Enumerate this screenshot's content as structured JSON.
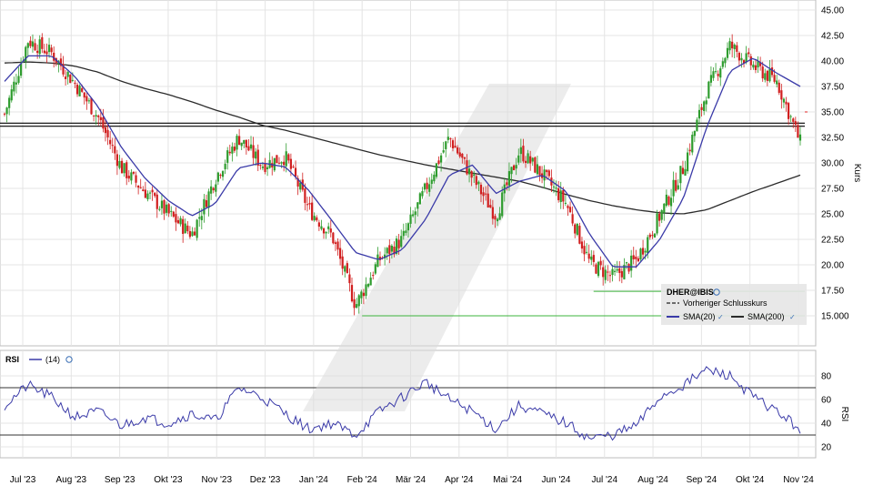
{
  "chart_data": [
    {
      "type": "candlestick",
      "title": "",
      "ylabel": "Kurs",
      "ylim": [
        12.5,
        46.2
      ],
      "y_ticks": [
        "45.00",
        "42.50",
        "40.00",
        "37.50",
        "35.00",
        "32.50",
        "30.00",
        "27.50",
        "25.00",
        "22.50",
        "20.00",
        "17.50",
        "15.000"
      ],
      "x_ticks": [
        "Jul '23",
        "Aug '23",
        "Sep '23",
        "Okt '23",
        "Nov '23",
        "Dez '23",
        "Jan '24",
        "Feb '24",
        "Mär '24",
        "Apr '24",
        "Mai '24",
        "Jun '24",
        "Jul '24",
        "Aug '24",
        "Sep '24",
        "Okt '24",
        "Nov '24"
      ],
      "grid": true,
      "legend": {
        "position": "bottom-right",
        "symbol": "DHER@IBIS",
        "items": [
          {
            "label": "Vorheriger Schlusskurs",
            "style": "dashed",
            "color": "#222222"
          },
          {
            "label": "SMA(20)",
            "style": "solid",
            "color": "#3a3aa8"
          },
          {
            "label": "SMA(200)",
            "style": "solid",
            "color": "#2b2b2b"
          }
        ]
      },
      "colors": {
        "up": "#2e9c2e",
        "down": "#d11f1f",
        "sma20": "#3a3aa8",
        "sma200": "#2b2b2b",
        "support": "#3cb43c",
        "resistance": "#e23a3a",
        "hline": "#000000"
      },
      "horizontal_lines": [
        {
          "value": 33.9,
          "color": "#000000",
          "label": ""
        },
        {
          "value": 33.6,
          "color": "#000000",
          "label": ""
        },
        {
          "value": 35.0,
          "color": "#e23a3a",
          "label": "",
          "from": "Nov '24"
        },
        {
          "value": 17.4,
          "color": "#3cb43c",
          "label": "",
          "from": "Jul '24"
        },
        {
          "value": 15.0,
          "color": "#3cb43c",
          "label": "",
          "from": "Feb '24"
        }
      ],
      "close_series": {
        "x": [
          "Jul '23",
          "",
          "Aug '23",
          "",
          "Sep '23",
          "",
          "Okt '23",
          "",
          "Nov '23",
          "",
          "Dez '23",
          "",
          "Jan '24",
          "",
          "Feb '24",
          "",
          "Mär '24",
          "",
          "Apr '24",
          "",
          "Mai '24",
          "",
          "Jun '24",
          "",
          "Jul '24",
          "",
          "Aug '24",
          "",
          "Sep '24",
          "",
          "Okt '24",
          "",
          "Nov '24",
          "",
          ""
        ],
        "values": [
          34.8,
          42.0,
          40.8,
          37.8,
          34.5,
          29.5,
          27.2,
          25.0,
          23.0,
          28.5,
          32.5,
          29.8,
          30.6,
          25.5,
          22.8,
          16.0,
          20.5,
          22.5,
          27.5,
          32.5,
          28.5,
          24.8,
          31.2,
          28.8,
          26.0,
          20.2,
          18.8,
          20.5,
          24.8,
          29.5,
          37.0,
          41.5,
          39.5,
          38.0,
          32.0
        ]
      },
      "sma20": [
        38.0,
        40.5,
        40.5,
        38.5,
        35.5,
        31.5,
        28.5,
        26.3,
        24.8,
        26.0,
        29.5,
        30.0,
        29.6,
        27.3,
        24.3,
        21.2,
        20.5,
        21.5,
        24.5,
        28.8,
        29.8,
        27.0,
        28.2,
        28.8,
        27.2,
        23.0,
        19.8,
        19.8,
        22.5,
        26.5,
        33.5,
        39.0,
        40.3,
        38.8,
        37.5
      ],
      "sma200": [
        39.8,
        39.9,
        39.8,
        39.5,
        38.9,
        38.0,
        37.3,
        36.7,
        36.0,
        35.2,
        34.5,
        33.7,
        33.2,
        32.6,
        32.0,
        31.4,
        30.8,
        30.3,
        29.8,
        29.4,
        29.0,
        28.6,
        28.2,
        27.6,
        26.9,
        26.3,
        25.8,
        25.4,
        25.1,
        25.0,
        25.4,
        26.3,
        27.2,
        28.0,
        28.8
      ]
    },
    {
      "type": "line",
      "title": "",
      "ylabel": "RSI",
      "series": [
        {
          "name": "RSI",
          "period": "(14)",
          "color": "#3a3aa8"
        }
      ],
      "ylim": [
        12,
        92
      ],
      "y_ticks": [
        "80",
        "60",
        "40",
        "20"
      ],
      "reference_lines": [
        70,
        30
      ],
      "values": [
        55,
        72,
        62,
        45,
        50,
        38,
        45,
        40,
        48,
        42,
        70,
        62,
        48,
        35,
        40,
        30,
        50,
        62,
        75,
        60,
        50,
        35,
        55,
        48,
        40,
        27,
        30,
        38,
        62,
        72,
        85,
        80,
        62,
        50,
        35
      ]
    }
  ]
}
